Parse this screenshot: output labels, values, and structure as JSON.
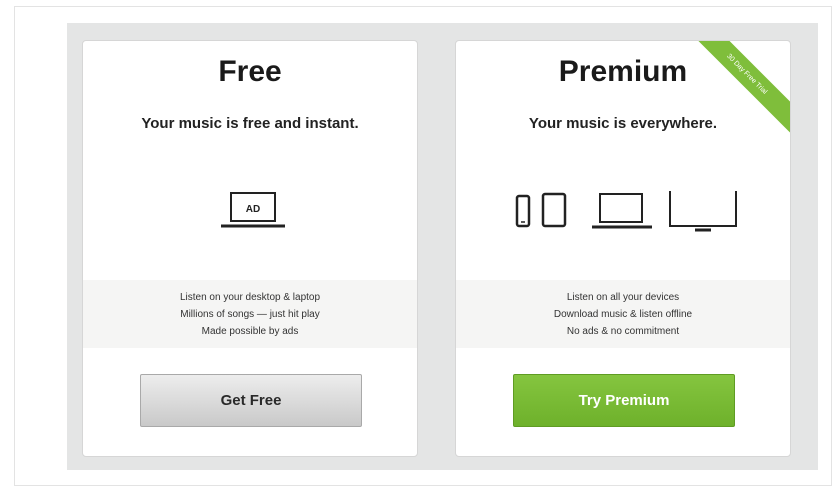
{
  "plans": {
    "free": {
      "title": "Free",
      "subtitle": "Your music is free and instant.",
      "device_label": "AD",
      "features": [
        "Listen on your desktop & laptop",
        "Millions of songs — just hit play",
        "Made possible by ads"
      ],
      "button_label": "Get Free"
    },
    "premium": {
      "title": "Premium",
      "subtitle": "Your music is everywhere.",
      "ribbon": "30 Day Free Trial",
      "features": [
        "Listen on all your devices",
        "Download music & listen offline",
        "No ads & no commitment"
      ],
      "button_label": "Try Premium"
    }
  },
  "icons": {
    "free": [
      "laptop-ad-icon"
    ],
    "premium": [
      "phone-icon",
      "tablet-icon",
      "laptop-icon",
      "monitor-icon"
    ]
  },
  "colors": {
    "accent_green": "#77b835",
    "panel_bg": "#e4e5e5",
    "grey_button": "#d8d8d8"
  }
}
